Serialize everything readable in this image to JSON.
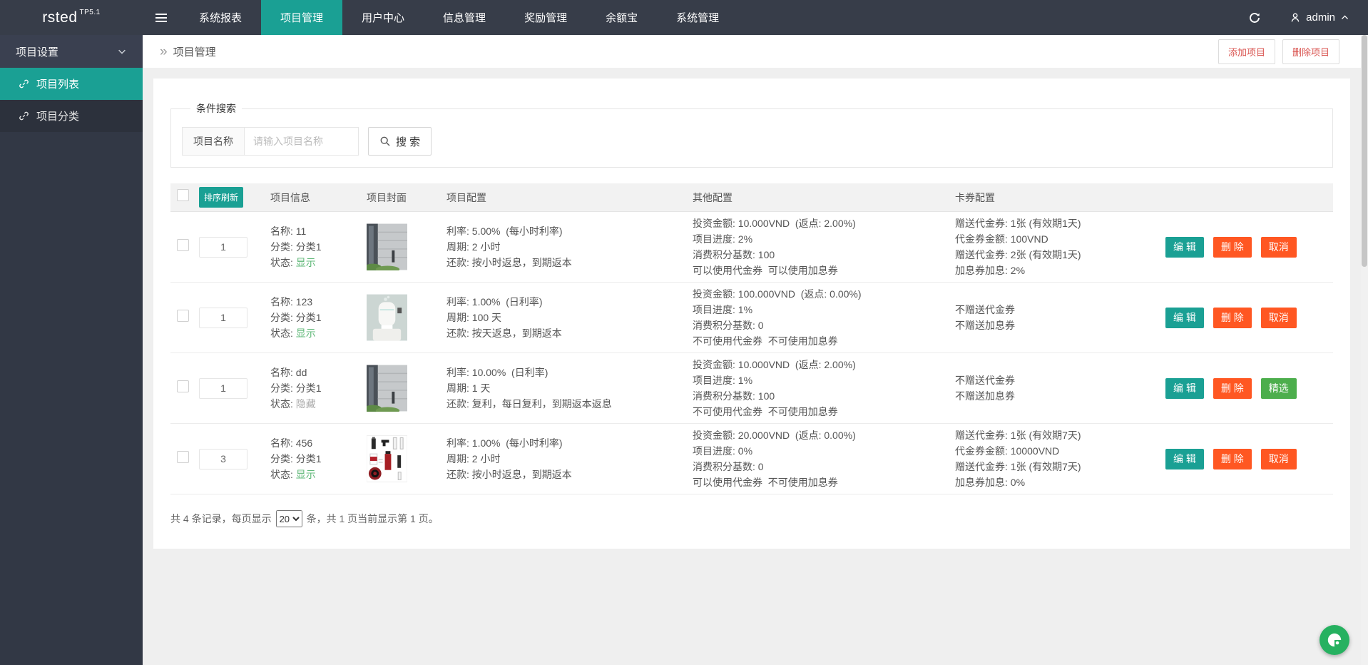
{
  "header": {
    "logo": "rsted",
    "logo_sub": "TP5.1",
    "nav": [
      {
        "label": "系统报表",
        "active": false
      },
      {
        "label": "项目管理",
        "active": true
      },
      {
        "label": "用户中心",
        "active": false
      },
      {
        "label": "信息管理",
        "active": false
      },
      {
        "label": "奖励管理",
        "active": false
      },
      {
        "label": "余额宝",
        "active": false
      },
      {
        "label": "系统管理",
        "active": false
      }
    ],
    "username": "admin"
  },
  "sidebar": {
    "group_label": "项目设置",
    "items": [
      {
        "label": "项目列表",
        "active": true
      },
      {
        "label": "项目分类",
        "active": false
      }
    ]
  },
  "breadcrumb": {
    "title": "项目管理"
  },
  "toolbar": {
    "add_label": "添加项目",
    "delete_label": "删除项目"
  },
  "search": {
    "legend": "条件搜索",
    "field_label": "项目名称",
    "placeholder": "请输入项目名称",
    "button_label": "搜 索"
  },
  "table": {
    "headers": {
      "sort": "排序刷新",
      "info": "项目信息",
      "cover": "项目封面",
      "config": "项目配置",
      "other": "其他配置",
      "card": "卡券配置"
    },
    "rows": [
      {
        "sort": "1",
        "name": "名称: 11",
        "category": "分类: 分类1",
        "status_label": "状态: ",
        "status": "显示",
        "cover": "building",
        "config": [
          "利率: 5.00%  (每小时利率)",
          "周期: 2 小时",
          "还款: 按小时返息，到期返本"
        ],
        "other": [
          "投资金额: 10.000VND  (返点: 2.00%)",
          "项目进度: 2%",
          "消费积分基数: 100",
          "可以使用代金券  可以使用加息券"
        ],
        "card": [
          "赠送代金券: 1张 (有效期1天)",
          "代金券金额: 100VND",
          "赠送代金券: 2张 (有效期1天)",
          "加息券加息: 2%"
        ],
        "actions": [
          "编 辑",
          "删 除",
          "取消"
        ]
      },
      {
        "sort": "1",
        "name": "名称: 123",
        "category": "分类: 分类1",
        "status_label": "状态: ",
        "status": "显示",
        "cover": "humidifier",
        "config": [
          "利率: 1.00%  (日利率)",
          "周期: 100 天",
          "还款: 按天返息，到期返本"
        ],
        "other": [
          "投资金额: 100.000VND  (返点: 0.00%)",
          "项目进度: 1%",
          "消费积分基数: 0",
          "不可使用代金券  不可使用加息券"
        ],
        "card": [
          "不赠送代金券",
          "不赠送加息券"
        ],
        "actions": [
          "编 辑",
          "删 除",
          "取消"
        ]
      },
      {
        "sort": "1",
        "name": "名称: dd",
        "category": "分类: 分类1",
        "status_label": "状态: ",
        "status": "隐藏",
        "cover": "building",
        "config": [
          "利率: 10.00%  (日利率)",
          "周期: 1 天",
          "还款: 复利，每日复利，到期返本返息"
        ],
        "other": [
          "投资金额: 10.000VND  (返点: 2.00%)",
          "项目进度: 1%",
          "消费积分基数: 100",
          "不可使用代金券  不可使用加息券"
        ],
        "card": [
          "不赠送代金券",
          "不赠送加息券"
        ],
        "actions": [
          "编 辑",
          "删 除",
          "精选"
        ]
      },
      {
        "sort": "3",
        "name": "名称: 456",
        "category": "分类: 分类1",
        "status_label": "状态: ",
        "status": "显示",
        "cover": "products",
        "config": [
          "利率: 1.00%  (每小时利率)",
          "周期: 2 小时",
          "还款: 按小时返息，到期返本"
        ],
        "other": [
          "投资金额: 20.000VND  (返点: 0.00%)",
          "项目进度: 0%",
          "消费积分基数: 0",
          "可以使用代金券  不可使用加息券"
        ],
        "card": [
          "赠送代金券: 1张 (有效期7天)",
          "代金券金额: 10000VND",
          "赠送代金券: 1张 (有效期7天)",
          "加息券加息: 0%"
        ],
        "actions": [
          "编 辑",
          "删 除",
          "取消"
        ]
      }
    ]
  },
  "pagination": {
    "prefix": "共 4 条记录，每页显示",
    "page_size": "20",
    "suffix": "条，共 1 页当前显示第 1 页。"
  },
  "colors": {
    "header_bg": "#373d49",
    "accent_teal": "#1aa094",
    "danger_orange": "#ff5722",
    "success_green": "#4cae4c",
    "status_show_green": "#5FB878",
    "link_red": "#d9534f",
    "fab_green": "#26b160"
  }
}
